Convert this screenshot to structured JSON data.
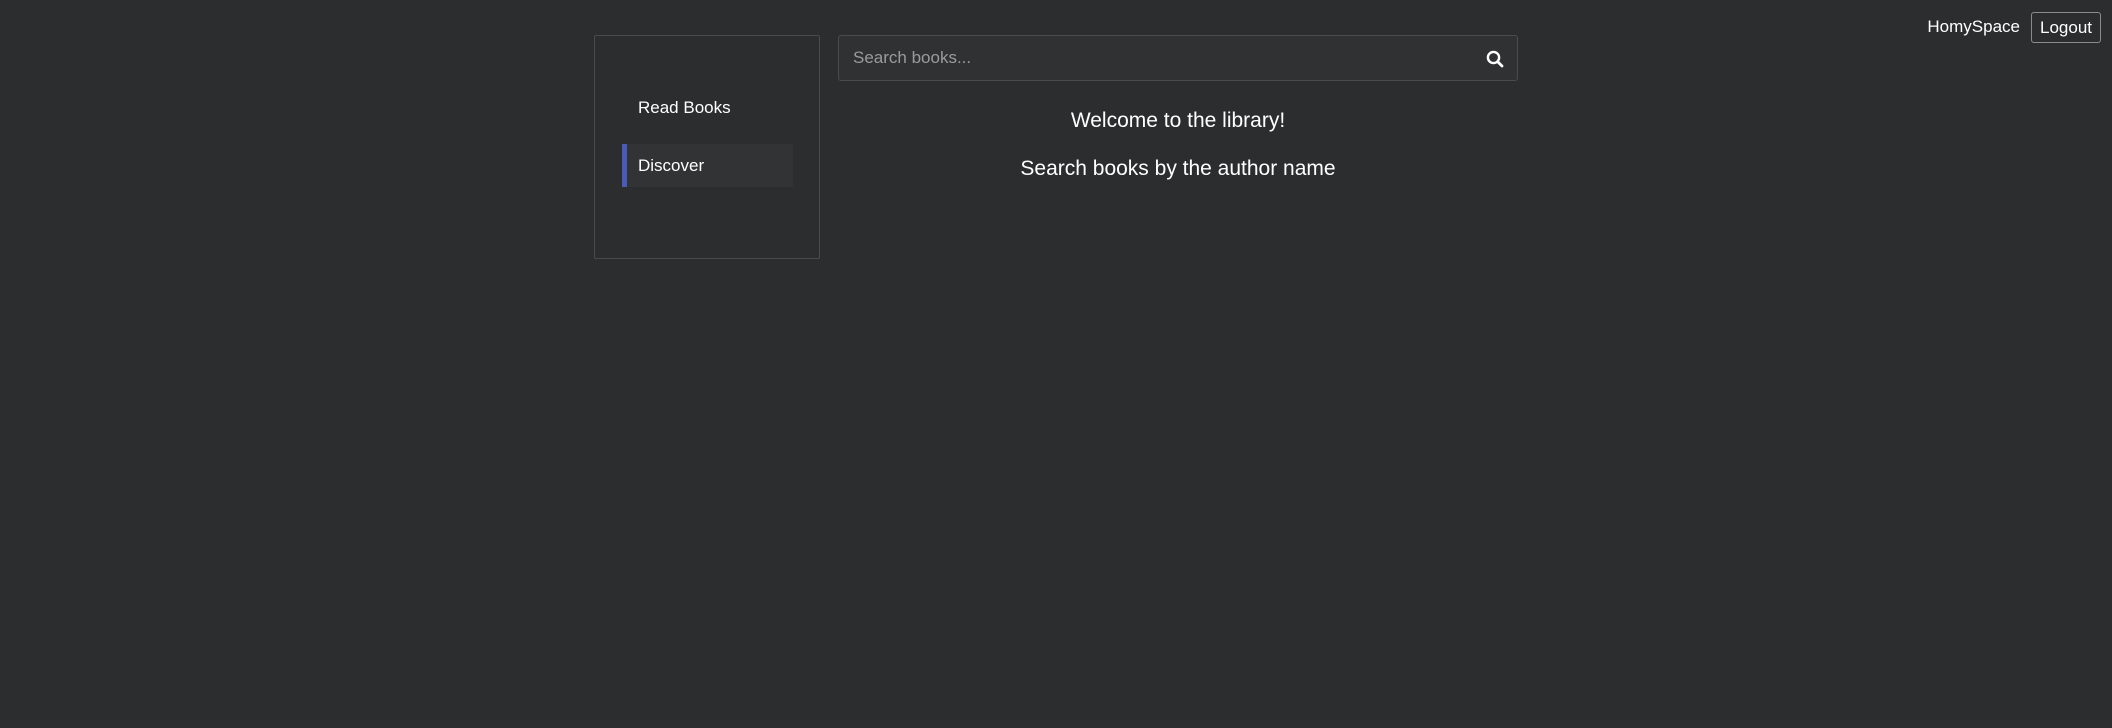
{
  "header": {
    "brand": "HomySpace",
    "logout_label": "Logout"
  },
  "sidebar": {
    "items": [
      {
        "label": "Read Books",
        "active": false
      },
      {
        "label": "Discover",
        "active": true
      }
    ]
  },
  "search": {
    "placeholder": "Search books...",
    "value": "",
    "icon": "search-icon"
  },
  "main": {
    "welcome": "Welcome to the library!",
    "subtitle": "Search books by the author name"
  },
  "colors": {
    "background": "#2c2d2f",
    "accent": "#4a5ab8",
    "border": "#4a4b4d"
  }
}
